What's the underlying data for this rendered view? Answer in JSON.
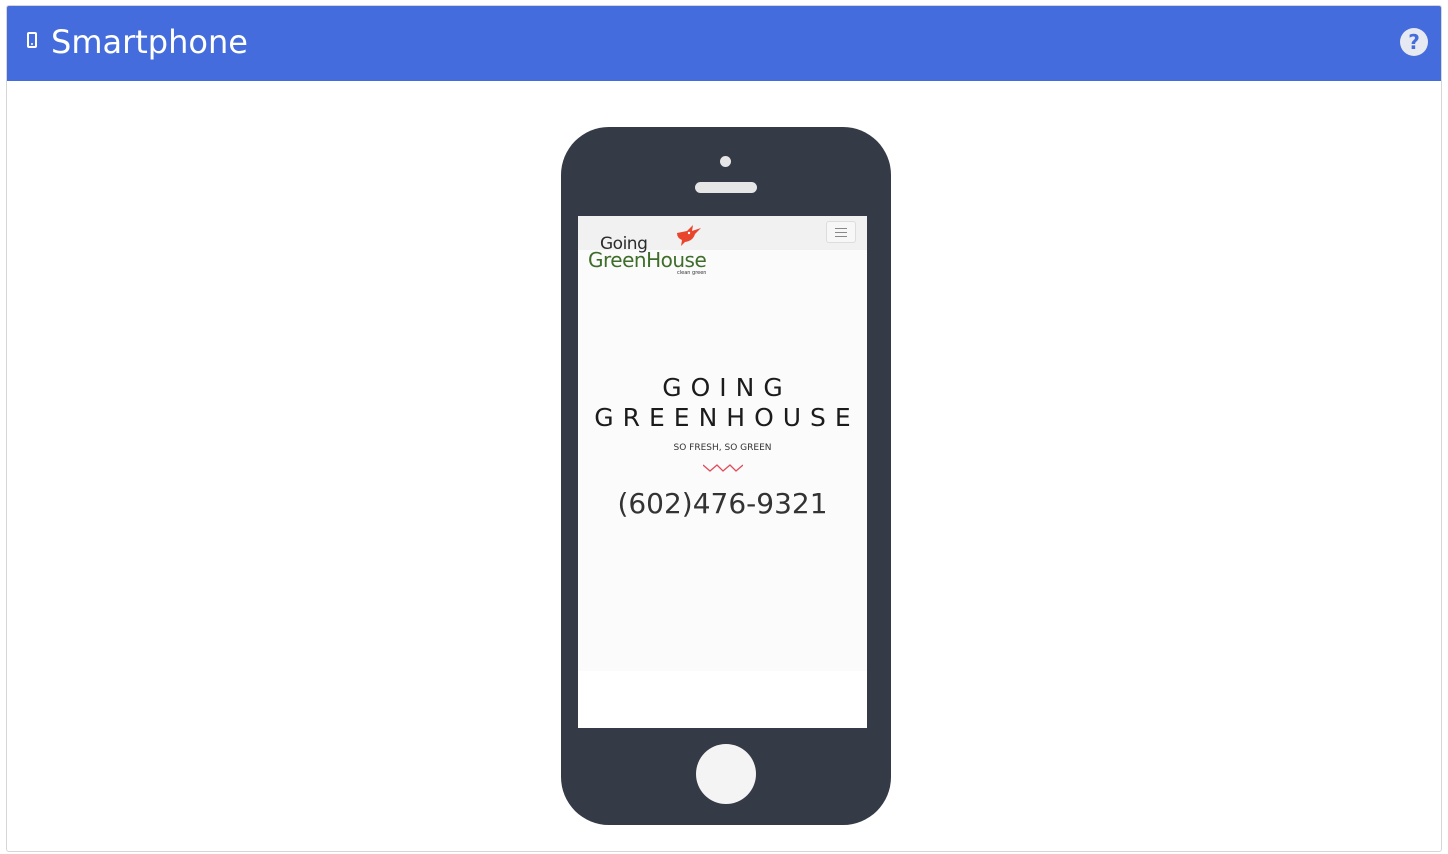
{
  "header": {
    "title": "Smartphone",
    "icon": "smartphone-icon",
    "help_icon": "question-circle-icon",
    "background_color": "#456cdd"
  },
  "phone": {
    "body_color": "#343a46",
    "screen": {
      "logo": {
        "line1": "Going",
        "line2": "GreenHouse",
        "tagline": "clean green",
        "icon": "bird-icon"
      },
      "menu_icon": "hamburger-menu-icon",
      "hero": {
        "title_line1": "GOING",
        "title_line2": "GREENHOUSE",
        "subtitle": "SO FRESH, SO GREEN",
        "divider_icon": "zigzag-divider-icon",
        "phone_number": "(602)476-9321"
      }
    }
  }
}
